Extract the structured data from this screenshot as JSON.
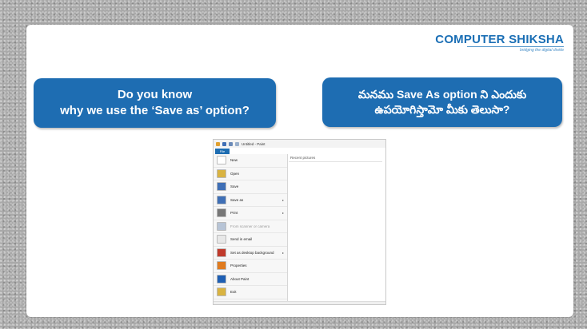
{
  "logo": {
    "brand": "COMPUTER SHIKSHA",
    "tagline": "bridging the digital divide"
  },
  "bubbles": {
    "english_line1": "Do you know",
    "english_line2": "why we use the ‘Save as’ option?",
    "telugu_line1": "మనము Save As option ని ఎందుకు",
    "telugu_line2": "ఉపయోగిస్తామో మీకు తెలుసా?"
  },
  "paint": {
    "title": "Untitled - Paint",
    "file_tab": "File",
    "recent_label": "Recent pictures",
    "menu": [
      {
        "label": "New",
        "icon": "new-file-icon",
        "color": "#ffffff",
        "arrow": false,
        "disabled": false
      },
      {
        "label": "Open",
        "icon": "open-folder-icon",
        "color": "#d9b341",
        "arrow": false,
        "disabled": false
      },
      {
        "label": "Save",
        "icon": "save-disk-icon",
        "color": "#3f6fb6",
        "arrow": false,
        "disabled": false
      },
      {
        "label": "Save as",
        "icon": "save-as-icon",
        "color": "#3f6fb6",
        "arrow": true,
        "disabled": false
      },
      {
        "label": "Print",
        "icon": "printer-icon",
        "color": "#777777",
        "arrow": true,
        "disabled": false
      },
      {
        "label": "From scanner or camera",
        "icon": "scanner-icon",
        "color": "#b7c4d6",
        "arrow": false,
        "disabled": true
      },
      {
        "label": "Send in email",
        "icon": "email-icon",
        "color": "#e8e8e8",
        "arrow": false,
        "disabled": false
      },
      {
        "label": "Set as desktop background",
        "icon": "desktop-background-icon",
        "color": "#c0392b",
        "arrow": true,
        "disabled": false
      },
      {
        "label": "Properties",
        "icon": "checkmark-icon",
        "color": "#e07b1f",
        "arrow": false,
        "disabled": false
      },
      {
        "label": "About Paint",
        "icon": "info-icon",
        "color": "#1e5fb4",
        "arrow": false,
        "disabled": false
      },
      {
        "label": "Exit",
        "icon": "exit-icon",
        "color": "#d9b341",
        "arrow": false,
        "disabled": false
      }
    ]
  },
  "colors": {
    "bubble": "#1e6db2",
    "brand": "#1b6fb5"
  }
}
